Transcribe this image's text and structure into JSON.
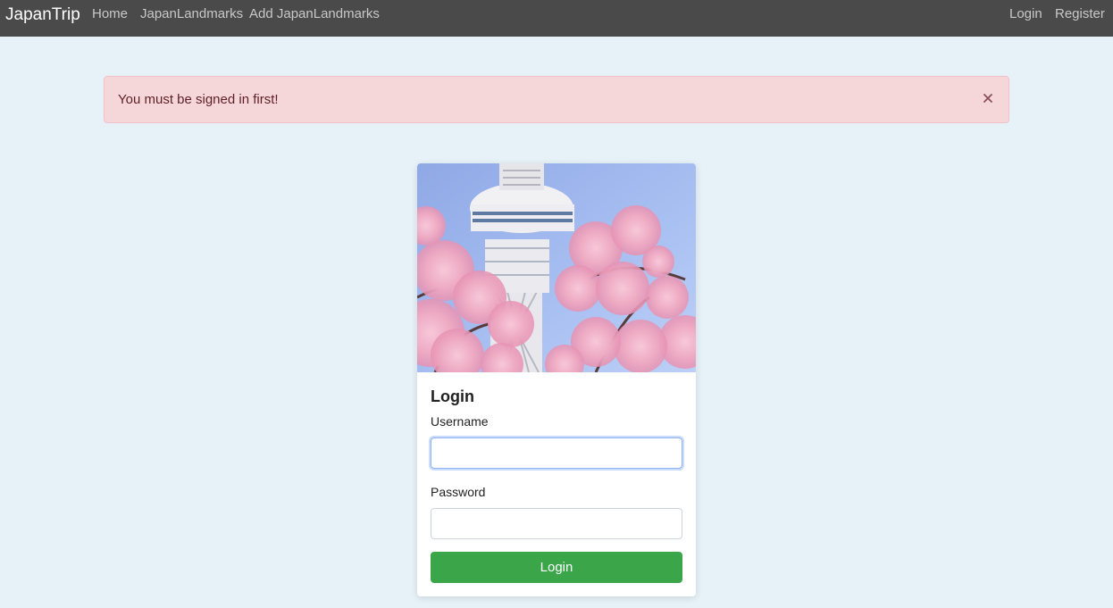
{
  "navbar": {
    "brand": "JapanTrip",
    "left_links": [
      "Home",
      "JapanLandmarks",
      "Add JapanLandmarks"
    ],
    "right_links": [
      "Login",
      "Register"
    ],
    "background": "#4a4a4a"
  },
  "alert": {
    "message": "You must be signed in first!",
    "close_icon": "close-icon",
    "background": "#f5d7da"
  },
  "login_card": {
    "image": "tokyo-skytree-cherry-blossoms",
    "title": "Login",
    "username_label": "Username",
    "username_value": "",
    "password_label": "Password",
    "password_value": "",
    "submit_label": "Login",
    "accent": "#3ba54a"
  }
}
